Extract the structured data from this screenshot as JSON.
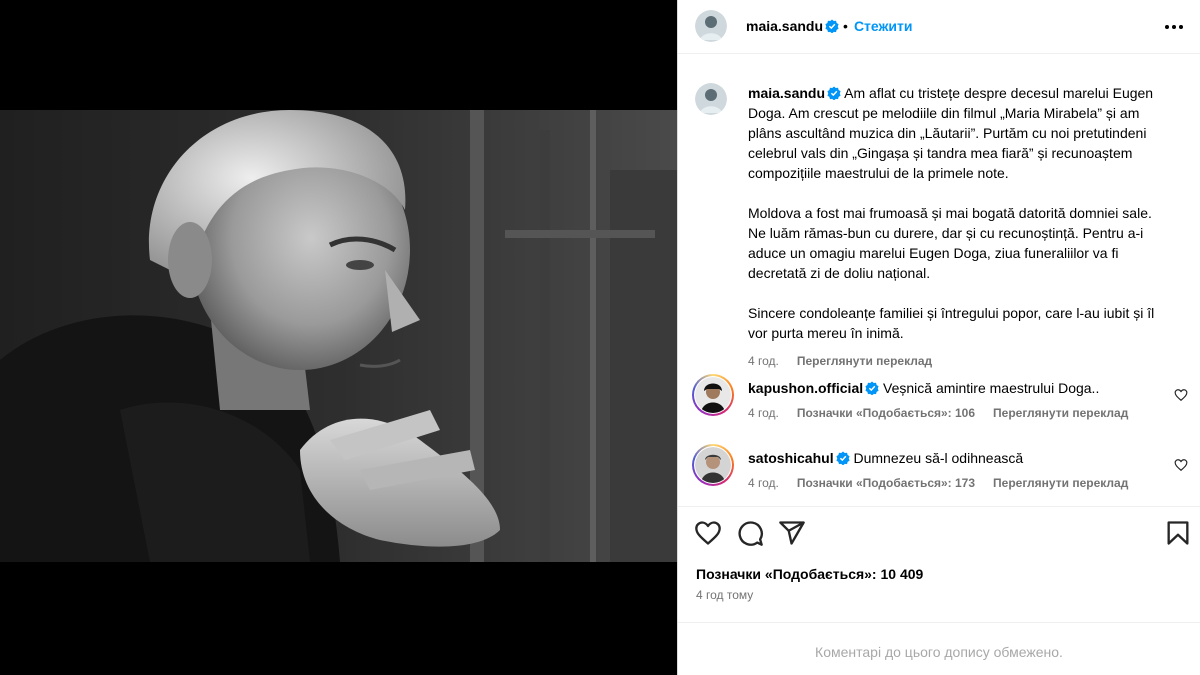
{
  "post": {
    "author": "maia.sandu",
    "follow_label": "Стежити",
    "more_icon": "more-horizontal-icon",
    "photo_alt_subject": "black-and-white portrait photo",
    "caption_paragraphs": [
      "Am aflat cu tristețe despre decesul marelui Eugen Doga. Am crescut pe melodiile din filmul „Maria Mirabela” și am plâns ascultând muzica din „Lăutarii”. Purtăm cu noi pretutindeni celebrul vals din „Gingașa și tandra mea fiară” și recunoaștem compozițiile maestrului de la primele note.",
      "Moldova a fost mai frumoasă și mai bogată datorită domniei sale. Ne luăm rămas-bun cu durere, dar și cu recunoștință. Pentru a-i aduce un omagiu marelui Eugen Doga, ziua funeraliilor va fi decretată zi de doliu național.",
      "Sincere condoleanțe familiei și întregului popor, care l-au iubit și îl vor purta mereu în inimă."
    ],
    "caption_time": "4 год.",
    "caption_translate": "Переглянути переклад",
    "likes_text": "Позначки «Подобається»: 10 409",
    "time_ago": "4 год тому",
    "comments_limited": "Коментарі до цього допису обмежено."
  },
  "comments": [
    {
      "user": "kapushon.official",
      "text": "Veșnică amintire maestrului Doga..",
      "time": "4 год.",
      "likes": "Позначки «Подобається»: 106",
      "translate": "Переглянути переклад"
    },
    {
      "user": "satoshicahul",
      "text": "Dumnezeu să-l odihnească",
      "time": "4 год.",
      "likes": "Позначки «Подобається»: 173",
      "translate": "Переглянути переклад"
    }
  ],
  "icons": {
    "verified": "verified-badge-icon",
    "like": "heart-icon",
    "comment": "comment-icon",
    "share": "share-icon",
    "save": "bookmark-icon"
  },
  "colors": {
    "link_blue": "#0095f6",
    "verified_blue": "#0095f6",
    "meta_gray": "#737373",
    "divider": "#efefef"
  }
}
